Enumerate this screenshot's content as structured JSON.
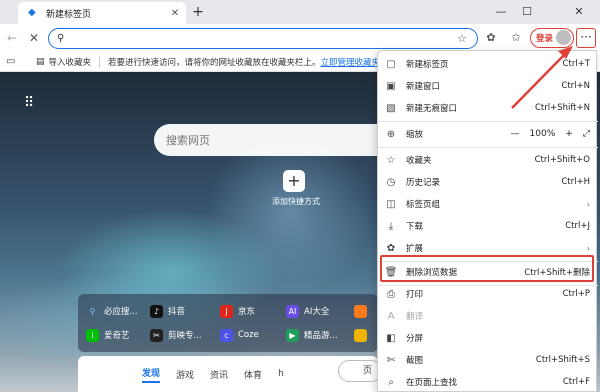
{
  "tab": {
    "title": "新建标签页",
    "close_glyph": "✕",
    "favicon": "edge-icon"
  },
  "window": {
    "minimize": "—",
    "maximize": "☐",
    "close": "✕",
    "newtab": "+"
  },
  "nav": {
    "back": "←",
    "stop": "✕",
    "omnibox_value": ""
  },
  "toolbar": {
    "login": "登录",
    "more": "···"
  },
  "bookmarks": {
    "import_label": "导入收藏夹",
    "hint": "若要进行快速访问，请将你的网址收藏放在收藏夹栏上。",
    "link": "立即管理收藏夹"
  },
  "newtab": {
    "search_placeholder": "搜索网页",
    "add_quick": "添加快捷方式",
    "quick_links": [
      {
        "label": "必应搜...",
        "color": "#2f6fd6",
        "icon": "search-icon"
      },
      {
        "label": "抖音",
        "color": "#111111",
        "icon": "douyin-icon"
      },
      {
        "label": "京东",
        "color": "#e1251b",
        "icon": "jd-icon"
      },
      {
        "label": "AI大全",
        "color": "#6b4ee6",
        "icon": "ai-icon"
      },
      {
        "label": "",
        "color": "#ff7a1a",
        "icon": "partial-icon"
      },
      {
        "label": "爱奇艺",
        "color": "#00be06",
        "icon": "iqiyi-icon"
      },
      {
        "label": "剪映专...",
        "color": "#222222",
        "icon": "capcut-icon"
      },
      {
        "label": "Coze",
        "color": "#4d53e8",
        "icon": "coze-icon"
      },
      {
        "label": "精品游...",
        "color": "#1e9e5a",
        "icon": "game-icon"
      },
      {
        "label": "",
        "color": "#f0b400",
        "icon": "partial-icon"
      }
    ],
    "feed_tabs": [
      "发现",
      "游戏",
      "资讯",
      "体育",
      "h"
    ],
    "page_pill": "页"
  },
  "menu": {
    "items": [
      {
        "icon": "new-tab-icon",
        "label": "新建标签页",
        "shortcut": "Ctrl+T"
      },
      {
        "icon": "new-window-icon",
        "label": "新建窗口",
        "shortcut": "Ctrl+N"
      },
      {
        "icon": "inprivate-icon",
        "label": "新建无痕窗口",
        "shortcut": "Ctrl+Shift+N"
      },
      {
        "icon": "zoom-icon",
        "label": "缩放",
        "zoom": {
          "minus": "—",
          "value": "100%",
          "plus": "+",
          "fullscreen": "⤢"
        }
      },
      {
        "icon": "favorites-icon",
        "label": "收藏夹",
        "shortcut": "Ctrl+Shift+O"
      },
      {
        "icon": "history-icon",
        "label": "历史记录",
        "shortcut": "Ctrl+H"
      },
      {
        "icon": "tab-groups-icon",
        "label": "标签页组",
        "arrow": "›"
      },
      {
        "icon": "downloads-icon",
        "label": "下载",
        "shortcut": "Ctrl+J"
      },
      {
        "icon": "extensions-icon",
        "label": "扩展",
        "arrow": "›"
      },
      {
        "icon": "delete-icon",
        "label": "删除浏览数据",
        "shortcut": "Ctrl+Shift+删除"
      },
      {
        "icon": "print-icon",
        "label": "打印",
        "shortcut": "Ctrl+P"
      },
      {
        "icon": "translate-icon",
        "label": "翻译",
        "disabled": true
      },
      {
        "icon": "split-screen-icon",
        "label": "分屏"
      },
      {
        "icon": "screenshot-icon",
        "label": "截图",
        "shortcut": "Ctrl+Shift+S"
      },
      {
        "icon": "find-icon",
        "label": "在页面上查找",
        "shortcut": "Ctrl+F"
      }
    ]
  },
  "accent": {
    "annotation_red": "#e0403a",
    "link_blue": "#1a73e8"
  }
}
